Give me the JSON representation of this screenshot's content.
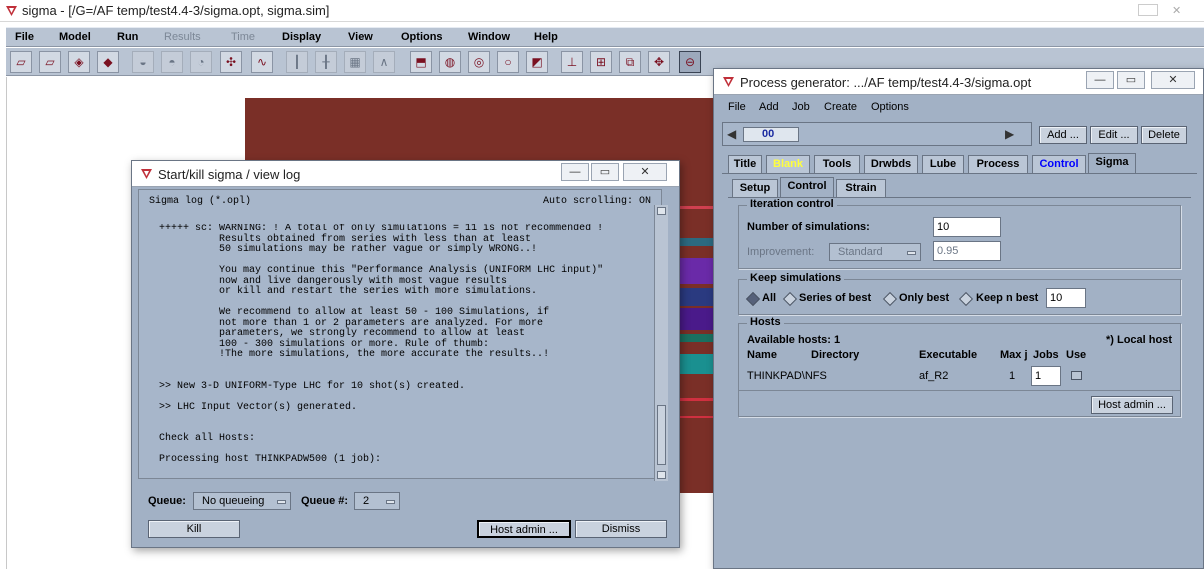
{
  "main": {
    "title": "sigma - [/G=/AF temp/test4.4-3/sigma.opt, sigma.sim]",
    "menu": [
      "File",
      "Model",
      "Run",
      "Results",
      "Time",
      "Display",
      "View",
      "Options",
      "Window",
      "Help"
    ],
    "menu_disabled": [
      "Results",
      "Time"
    ]
  },
  "log_window": {
    "title": "Start/kill sigma / view log",
    "header_left": "Sigma log (*.opl)",
    "header_right": "Auto scrolling: ON",
    "lines": [
      "+++++ sc: WARNING: ! A total of only simulations = 11 is not recommended !",
      "          Results obtained from series with less than at least",
      "          50 simulations may be rather vague or simply WRONG..!",
      "",
      "          You may continue this \"Performance Analysis (UNIFORM LHC input)\"",
      "          now and live dangerously with most vague results",
      "          or kill and restart the series with more simulations.",
      "",
      "          We recommend to allow at least 50 - 100 Simulations, if",
      "          not more than 1 or 2 parameters are analyzed. For more",
      "          parameters, we strongly recommend to allow at least",
      "          100 - 300 simulations or more. Rule of thumb:",
      "          !The more simulations, the more accurate the results..!",
      "",
      "",
      ">> New 3-D UNIFORM-Type LHC for 10 shot(s) created.",
      "",
      ">> LHC Input Vector(s) generated.",
      "",
      "",
      "Check all Hosts:",
      "",
      "Processing host THINKPADW500 (1 job):"
    ],
    "queue_label": "Queue:",
    "queue_value": "No queueing",
    "queue_num_label": "Queue #:",
    "queue_num_value": "2",
    "kill_label": "Kill",
    "host_admin_label": "Host admin ...",
    "dismiss_label": "Dismiss"
  },
  "proc_window": {
    "title": "Process generator: .../AF temp/test4.4-3/sigma.opt",
    "menu": [
      "File",
      "Add",
      "Job",
      "Create",
      "Options"
    ],
    "selector_value": "00",
    "add_label": "Add ...",
    "edit_label": "Edit ...",
    "delete_label": "Delete",
    "tabs": [
      "Title",
      "Blank",
      "Tools",
      "Drwbds",
      "Lube",
      "Process",
      "Control",
      "Sigma"
    ],
    "active_tab": "Sigma",
    "subtabs": [
      "Setup",
      "Control",
      "Strain"
    ],
    "active_subtab": "Control",
    "iteration": {
      "title": "Iteration control",
      "num_sim_label": "Number of simulations:",
      "num_sim_value": "10",
      "improvement_label": "Improvement:",
      "improvement_value": "Standard",
      "improvement_factor": "0.95"
    },
    "keep": {
      "title": "Keep simulations",
      "options": [
        "All",
        "Series of best",
        "Only best",
        "Keep n best"
      ],
      "selected": "All",
      "n_value": "10"
    },
    "hosts": {
      "title": "Hosts",
      "available": "Available hosts: 1",
      "local_note": "*) Local host",
      "columns": [
        "Name",
        "Directory",
        "Executable",
        "Max j",
        "Jobs",
        "Use"
      ],
      "rows": [
        {
          "name": "THINKPAD\\NFS",
          "directory": "",
          "executable": "af_R2",
          "max_j": "1",
          "jobs": "1"
        }
      ],
      "host_admin_label": "Host admin ..."
    },
    "colors": {
      "blank_tab": "#ffff3c",
      "control_tab": "#0000ff"
    }
  }
}
